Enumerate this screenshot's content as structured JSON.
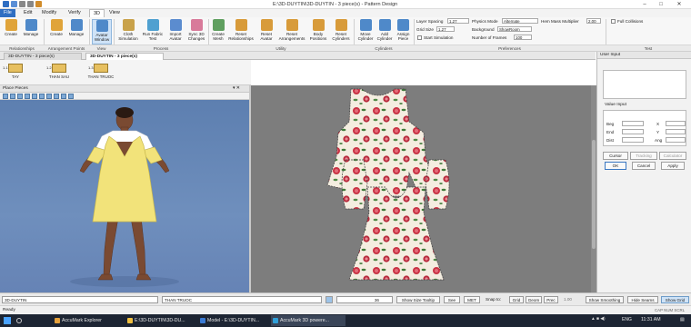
{
  "window": {
    "title": "E:\\3D-DUYTIN\\3D-DUYTIN - 3 piece(s) - Pattern Design",
    "controls": [
      "–",
      "□",
      "✕"
    ]
  },
  "menubar": {
    "items": [
      "File",
      "Edit",
      "Modify",
      "Verify",
      "3D",
      "View"
    ],
    "active": "File",
    "selected": "3D"
  },
  "ribbon": {
    "buttons": {
      "create": "Create",
      "manage": "Manage",
      "create2": "Create",
      "manage2": "Manage",
      "avatar_window": "Avatar Window",
      "cloth_sim": "Cloth Simulation",
      "run_fabric": "Run Fabric Test",
      "import_avatar": "Import Avatar",
      "sync_3d": "Sync 3D Changes",
      "create_mesh": "Create Mesh",
      "reset_rel": "Reset Relationships",
      "reset_avatar": "Reset Avatar",
      "reset_arr": "Reset Arrangements",
      "body_pos": "Body Positions",
      "reset_cyl": "Reset Cylinders",
      "move_cyl": "Move Cylinder",
      "add_cyl": "Add Cylinder",
      "assign_piece": "Assign Piece"
    },
    "groups": [
      "Relationships",
      "Arrangement Points",
      "View",
      "Process",
      "Utility",
      "Cylinders",
      "Preferences",
      "Test"
    ],
    "prefs": {
      "layer_spacing_label": "Layer Spacing",
      "layer_spacing": "1.27",
      "grid_size_label": "Grid Size",
      "grid_size": "1.27",
      "start_sim": "Start Simulation",
      "physics_label": "Physics Mode",
      "physics": "Alternate",
      "background_label": "Background",
      "background": "ShowRoom",
      "frames_label": "Number of Frames",
      "frames": "100",
      "hem_label": "Hem Mass Multiplier",
      "hem": "2.00",
      "full_collisions": "Full Collisions"
    }
  },
  "doctabs": [
    "3D-DUYTIN - 3 piece(s)",
    "3D-DUYTIN - 3 piece(s)"
  ],
  "pieces": [
    {
      "num": "1.1",
      "label": "TAY"
    },
    {
      "num": "1.2",
      "label": "THAN SAU"
    },
    {
      "num": "1.3",
      "label": "THAN TRUOC"
    }
  ],
  "place_pieces": {
    "title": "Place Pieces",
    "controls": "▾ ✕"
  },
  "user_input": {
    "title": "User Input",
    "value_input": "Value Input",
    "rows": [
      {
        "label": "Beg",
        "axis": "X"
      },
      {
        "label": "End",
        "axis": "Y"
      },
      {
        "label": "Dist",
        "axis": "Ang"
      }
    ],
    "tabs": [
      "Cursor",
      "Tracking",
      "Calculator"
    ],
    "buttons": [
      "OK",
      "Cancel",
      "Apply"
    ]
  },
  "statusbar": {
    "doc": "3D-DUYTIN",
    "piece": "THAN TRUOC",
    "zoom": "36",
    "show_size_tooltip": "Show Size Tooltip",
    "see": "See",
    "met": "MET",
    "snap_label": "Snap to:",
    "snap": [
      "Grid",
      "Geom",
      "Prec"
    ],
    "snap_value": "1.00",
    "show_smoothing": "Show Smoothing",
    "hide_seams": "Hide Seams",
    "show_grid": "Show Grid",
    "ready": "Ready",
    "indicators": "CAP  NUM  SCRL"
  },
  "taskbar": {
    "items": [
      "AccuMark Explorer",
      "E:\\3D-DUYTIN\\3D-DU...",
      "Model - E:\\3D-DUYTIN...",
      "AccuMark 3D powere..."
    ],
    "lang": "ENG",
    "time": "11:31 AM",
    "arrows": "▲ ■ ◀)",
    "notif": "▤"
  },
  "colors": {
    "accent": "#2f6ec2",
    "fabric_base": "#f4ede0",
    "rose": "#c93344",
    "leaf": "#3f7a3a",
    "dress": "#f2e37a"
  }
}
